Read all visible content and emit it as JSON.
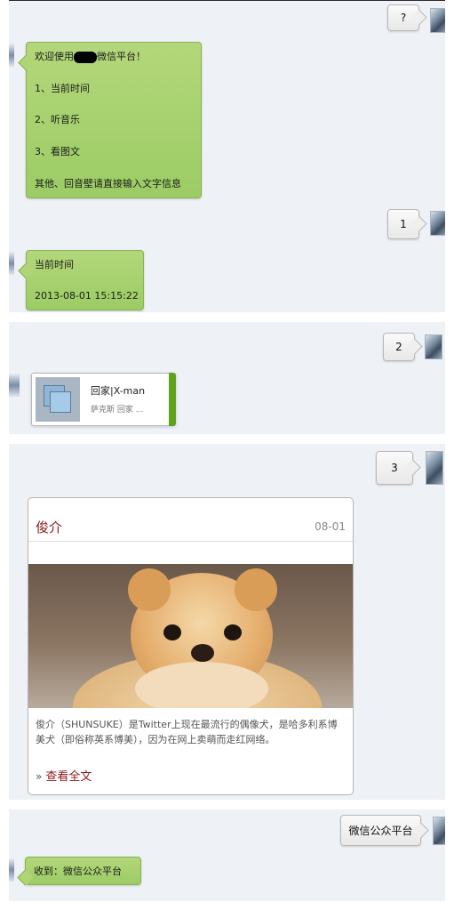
{
  "conversation": {
    "section1": {
      "user_msg1": "?",
      "welcome": {
        "line_before": "欢迎使用",
        "line_after": "微信平台！",
        "items": [
          "1、当前时间",
          "2、听音乐",
          "3、看图文"
        ],
        "footer": "其他、回音壁请直接输入文字信息"
      },
      "user_msg2": "1",
      "time_reply": {
        "label": "当前时间",
        "value": "2013-08-01 15:15:22"
      }
    },
    "section2": {
      "user_msg": "2",
      "music_card": {
        "title": "回家|X-man",
        "subtitle": "萨克斯 回家 ..."
      }
    },
    "section3": {
      "user_msg": "3",
      "news": {
        "title": "俊介",
        "date": "08-01",
        "description": "俊介（SHUNSUKE）是Twitter上现在最流行的偶像犬，是哈多利系博美犬（即俗称英系博美），因为在网上卖萌而走红网络。",
        "read_more": "查看全文",
        "read_more_icon": "»"
      }
    },
    "section4": {
      "user_msg": "微信公众平台",
      "reply": "收到：微信公众平台"
    }
  }
}
